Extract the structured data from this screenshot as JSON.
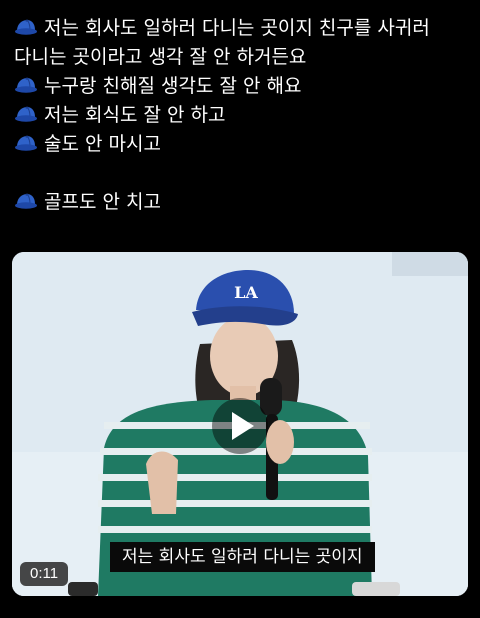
{
  "post": {
    "icon": "blue-cap-icon",
    "lines": [
      {
        "icon": true,
        "text": "저는 회사도 일하러 다니는 곳이지 친구를 사귀러"
      },
      {
        "icon": false,
        "text": "다니는 곳이라고 생각 잘 안 하거든요"
      },
      {
        "icon": true,
        "text": "누구랑 친해질 생각도 잘 안 해요"
      },
      {
        "icon": true,
        "text": "저는 회식도 잘 안 하고"
      },
      {
        "icon": true,
        "text": "술도 안 마시고"
      },
      {
        "icon": true,
        "text": "골프도 안 치고"
      }
    ]
  },
  "video": {
    "cap_logo": "LA",
    "subtitle": "저는 회사도 일하러 다니는 곳이지",
    "duration": "0:11",
    "play_icon": "play-icon",
    "colors": {
      "cap": "#2a4fae",
      "shirt_green": "#1f7a63",
      "shirt_stripe": "#e6eef0",
      "background": "#dfeaf2"
    }
  }
}
